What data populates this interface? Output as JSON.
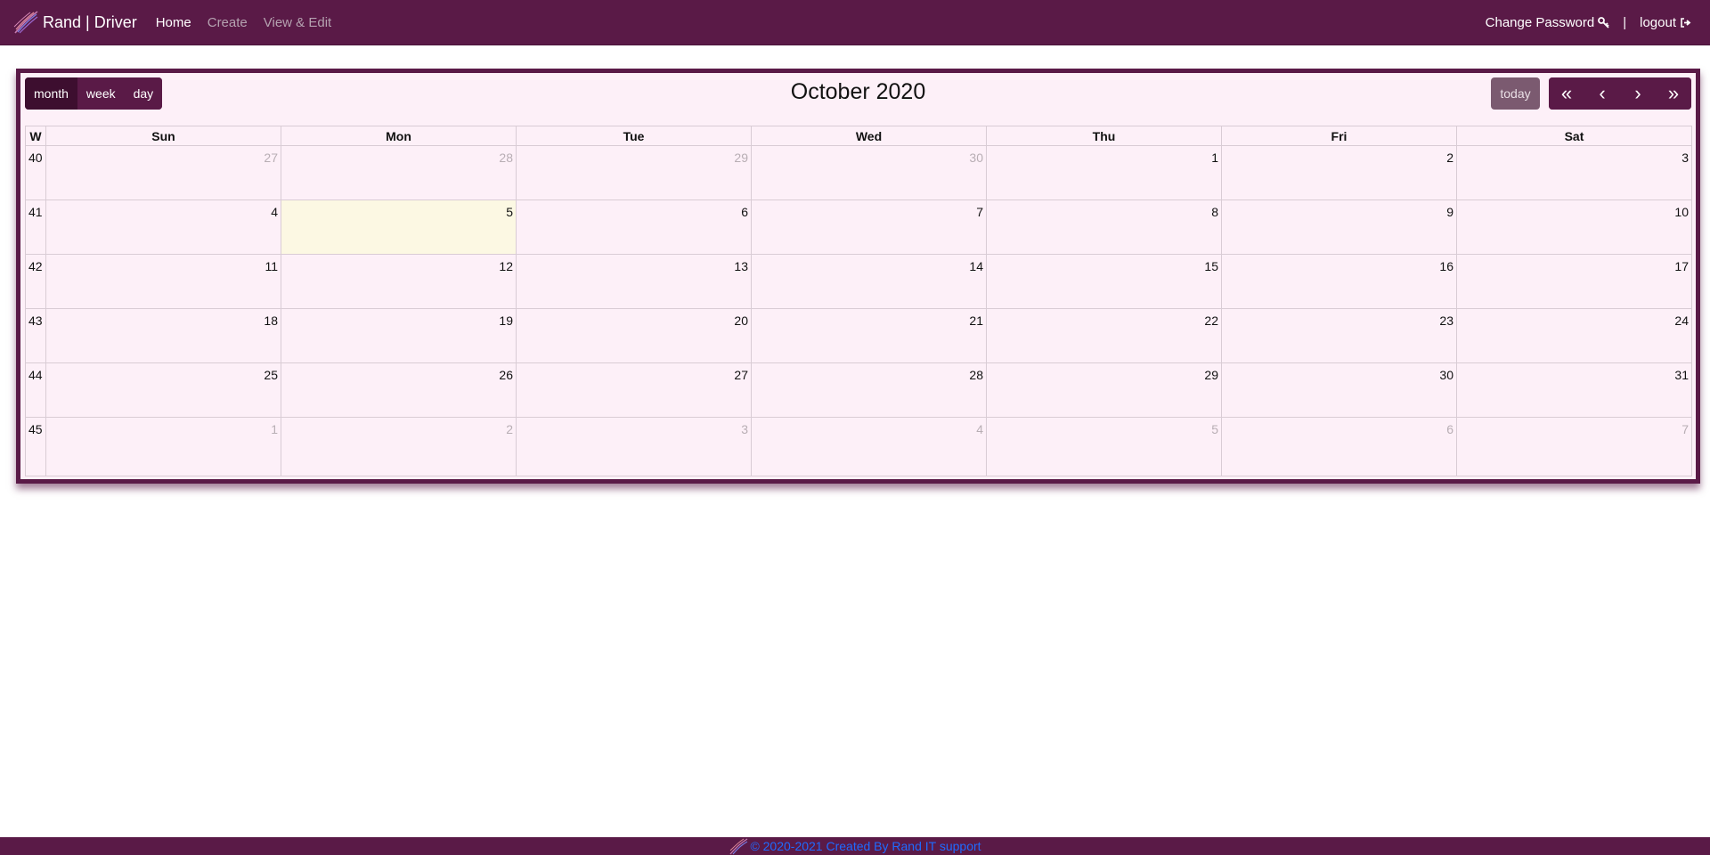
{
  "navbar": {
    "brand": "Rand | Driver",
    "links": [
      {
        "label": "Home",
        "active": true
      },
      {
        "label": "Create",
        "active": false
      },
      {
        "label": "View & Edit",
        "active": false
      }
    ],
    "change_password": "Change Password",
    "separator": "|",
    "logout": "logout",
    "icons": {
      "logo": "feather-logo-icon",
      "key": "key-icon",
      "logout": "sign-out-icon"
    }
  },
  "calendar": {
    "title": "October 2020",
    "views": [
      {
        "label": "month",
        "active": true
      },
      {
        "label": "week",
        "active": false
      },
      {
        "label": "day",
        "active": false
      }
    ],
    "today_label": "today",
    "nav_buttons": [
      {
        "icon": "double-chevron-left-icon",
        "glyph": "«"
      },
      {
        "icon": "chevron-left-icon",
        "glyph": "‹"
      },
      {
        "icon": "chevron-right-icon",
        "glyph": "›"
      },
      {
        "icon": "double-chevron-right-icon",
        "glyph": "»"
      }
    ],
    "week_header": "W",
    "day_headers": [
      "Sun",
      "Mon",
      "Tue",
      "Wed",
      "Thu",
      "Fri",
      "Sat"
    ],
    "weeks": [
      {
        "week": "40",
        "days": [
          {
            "d": "27",
            "other": true
          },
          {
            "d": "28",
            "other": true
          },
          {
            "d": "29",
            "other": true
          },
          {
            "d": "30",
            "other": true
          },
          {
            "d": "1"
          },
          {
            "d": "2"
          },
          {
            "d": "3"
          }
        ]
      },
      {
        "week": "41",
        "days": [
          {
            "d": "4"
          },
          {
            "d": "5",
            "today": true
          },
          {
            "d": "6"
          },
          {
            "d": "7"
          },
          {
            "d": "8"
          },
          {
            "d": "9"
          },
          {
            "d": "10"
          }
        ]
      },
      {
        "week": "42",
        "days": [
          {
            "d": "11"
          },
          {
            "d": "12"
          },
          {
            "d": "13"
          },
          {
            "d": "14"
          },
          {
            "d": "15"
          },
          {
            "d": "16"
          },
          {
            "d": "17"
          }
        ]
      },
      {
        "week": "43",
        "days": [
          {
            "d": "18"
          },
          {
            "d": "19"
          },
          {
            "d": "20"
          },
          {
            "d": "21"
          },
          {
            "d": "22"
          },
          {
            "d": "23"
          },
          {
            "d": "24"
          }
        ]
      },
      {
        "week": "44",
        "days": [
          {
            "d": "25"
          },
          {
            "d": "26"
          },
          {
            "d": "27"
          },
          {
            "d": "28"
          },
          {
            "d": "29"
          },
          {
            "d": "30"
          },
          {
            "d": "31"
          }
        ]
      },
      {
        "week": "45",
        "days": [
          {
            "d": "1",
            "other": true
          },
          {
            "d": "2",
            "other": true
          },
          {
            "d": "3",
            "other": true
          },
          {
            "d": "4",
            "other": true
          },
          {
            "d": "5",
            "other": true
          },
          {
            "d": "6",
            "other": true
          },
          {
            "d": "7",
            "other": true
          }
        ]
      }
    ]
  },
  "footer": {
    "text": "© 2020-2021 Created By Rand IT support"
  },
  "colors": {
    "brand": "#5a1a47",
    "calendar_bg": "#fdf0f8",
    "today_cell": "#fcf8e3",
    "footer_link": "#1f6bff"
  }
}
